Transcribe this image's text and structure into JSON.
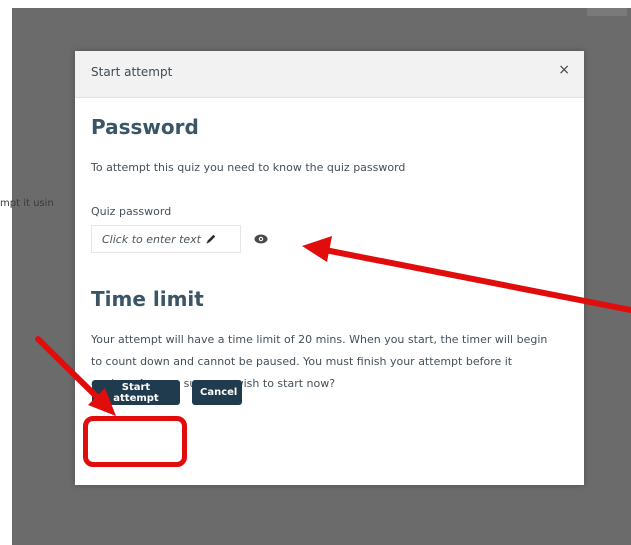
{
  "backdrop": {
    "partial_text": "mpt it usin"
  },
  "modal": {
    "title": "Start attempt",
    "close_label": "×",
    "password": {
      "heading": "Password",
      "intro": "To attempt this quiz you need to know the quiz password",
      "label": "Quiz password",
      "placeholder": "Click to enter text"
    },
    "time_limit": {
      "heading": "Time limit",
      "text": "Your attempt will have a time limit of 20 mins. When you start, the timer will begin to count down and cannot be paused. You must finish your attempt before it expires. Are you sure you wish to start now?"
    },
    "buttons": {
      "start": "Start attempt",
      "cancel": "Cancel"
    }
  },
  "annotations": {
    "color": "#e10d0d"
  },
  "colors": {
    "backdrop": "#6b6b6b",
    "heading": "#3a5566",
    "button": "#1f3b4d"
  },
  "icons": [
    "close-icon",
    "pencil-icon",
    "eye-icon"
  ]
}
